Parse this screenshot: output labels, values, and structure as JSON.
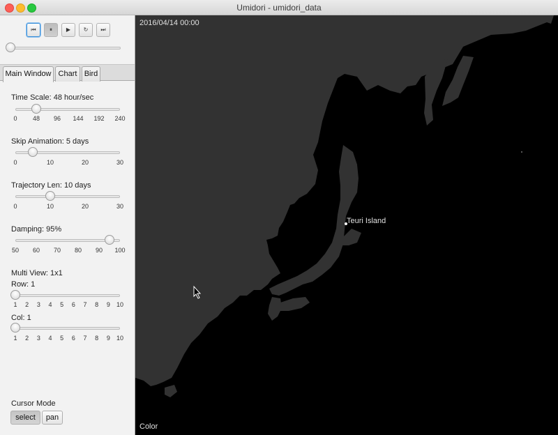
{
  "window": {
    "title": "Umidori - umidori_data"
  },
  "playback": {
    "buttons": [
      {
        "name": "skip-to-start-button",
        "icon": "skip-to-start-icon",
        "glyph": "⏮"
      },
      {
        "name": "pause-button",
        "icon": "pause-icon",
        "glyph": "⏸"
      },
      {
        "name": "play-button",
        "icon": "play-icon",
        "glyph": "▶"
      },
      {
        "name": "reload-button",
        "icon": "reload-icon",
        "glyph": "↻"
      },
      {
        "name": "skip-to-end-button",
        "icon": "skip-to-end-icon",
        "glyph": "⏭"
      }
    ],
    "progress": 0
  },
  "tabs": [
    {
      "label": "Main Window",
      "active": true
    },
    {
      "label": "Chart",
      "active": false
    },
    {
      "label": "Bird",
      "active": false
    }
  ],
  "controls": {
    "time_scale": {
      "label": "Time Scale: 48 hour/sec",
      "value": 48,
      "min": 0,
      "max": 240,
      "ticks": [
        "0",
        "48",
        "96",
        "144",
        "192",
        "240"
      ]
    },
    "skip_animation": {
      "label": "Skip Animation: 5 days",
      "value": 5,
      "min": 0,
      "max": 30,
      "ticks": [
        "0",
        "10",
        "20",
        "30"
      ]
    },
    "trajectory_len": {
      "label": "Trajectory Len: 10 days",
      "value": 10,
      "min": 0,
      "max": 30,
      "ticks": [
        "0",
        "10",
        "20",
        "30"
      ]
    },
    "damping": {
      "label": "Damping: 95%",
      "value": 95,
      "min": 50,
      "max": 100,
      "ticks": [
        "50",
        "60",
        "70",
        "80",
        "90",
        "100"
      ]
    },
    "multi_view": {
      "label": "Multi View: 1x1"
    },
    "row": {
      "label": "Row: 1",
      "value": 1,
      "min": 1,
      "max": 10,
      "ticks": [
        "1",
        "2",
        "3",
        "4",
        "5",
        "6",
        "7",
        "8",
        "9",
        "10"
      ]
    },
    "col": {
      "label": "Col: 1",
      "value": 1,
      "min": 1,
      "max": 10,
      "ticks": [
        "1",
        "2",
        "3",
        "4",
        "5",
        "6",
        "7",
        "8",
        "9",
        "10"
      ]
    }
  },
  "cursor_mode": {
    "label": "Cursor Mode",
    "select_label": "select",
    "pan_label": "pan",
    "selected": "select"
  },
  "map": {
    "timestamp": "2016/04/14 00:00",
    "location_label": "Teuri Island",
    "color_label": "Color",
    "land_color": "#323232",
    "sea_color": "#000000"
  }
}
